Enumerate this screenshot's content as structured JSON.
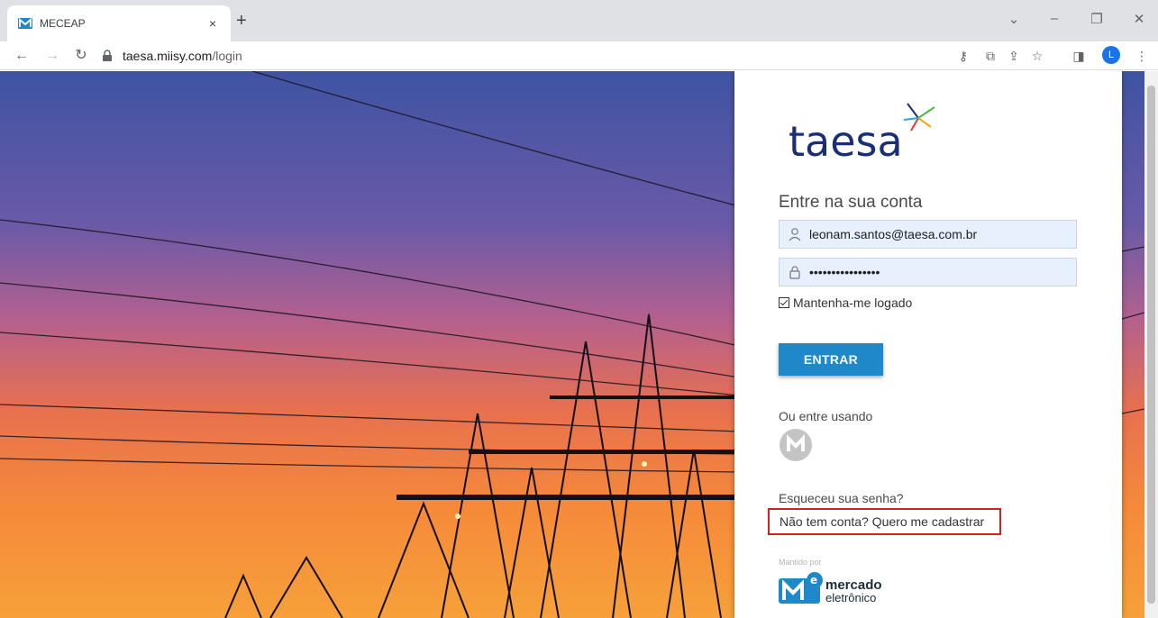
{
  "browser": {
    "tab_title": "MECEAP",
    "tab_close": "×",
    "new_tab": "+",
    "url_host": "taesa.miisy.com",
    "url_path": "/login",
    "profile_initial": "L"
  },
  "login": {
    "brand": "taesa",
    "heading": "Entre na sua conta",
    "email_value": "leonam.santos@taesa.com.br",
    "password_value": "••••••••••••••••",
    "remember_label": "Mantenha-me logado",
    "submit_label": "ENTRAR",
    "alt_login_label": "Ou entre usando",
    "forgot_label": "Esqueceu sua senha?",
    "register_label": "Não tem conta? Quero me cadastrar",
    "maintained_by": "Mantido por",
    "maintainer_line1": "mercado",
    "maintainer_line2": "eletrônico"
  },
  "colors": {
    "accent_button": "#1e88c9",
    "annotation_red": "#d32020"
  }
}
